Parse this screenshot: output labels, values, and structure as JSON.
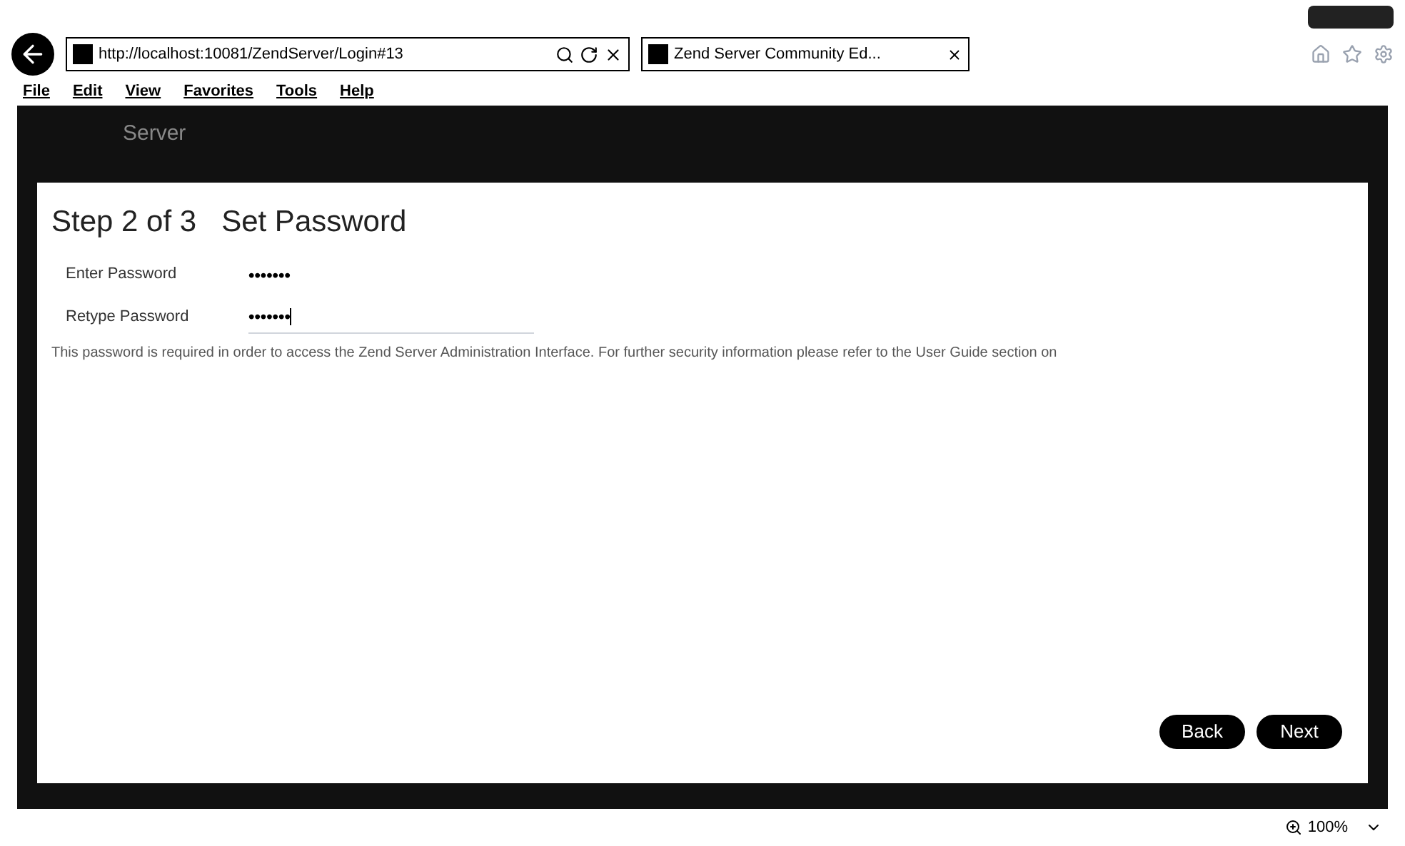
{
  "browser": {
    "address": "http://localhost:10081/ZendServer/Login#13",
    "tab_title": "Zend Server Community Ed...",
    "menu": [
      "File",
      "Edit",
      "View",
      "Favorites",
      "Tools",
      "Help"
    ],
    "zoom": "100%"
  },
  "header": {
    "logo_text": "Server"
  },
  "wizard": {
    "title": "Step 2 of 3   Set Password",
    "fields": [
      {
        "label": "Enter Password",
        "value": "•••••••",
        "focused": false
      },
      {
        "label": "Retype Password",
        "value": "•••••••",
        "focused": true
      }
    ],
    "note": "This password is required in order to access the Zend Server Administration Interface. For further security information please refer to the User Guide section on",
    "buttons": [
      "Back",
      "Next"
    ]
  }
}
